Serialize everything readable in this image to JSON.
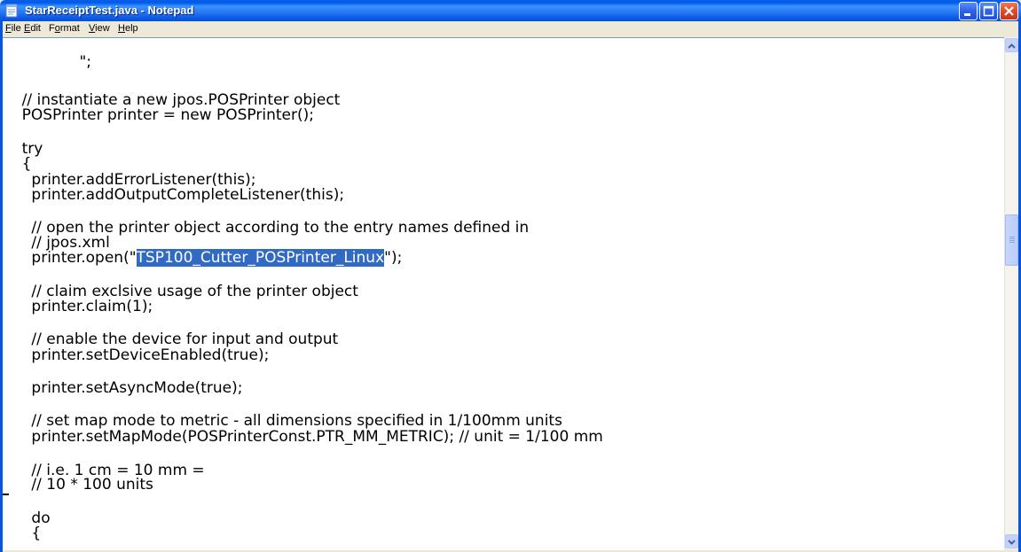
{
  "window": {
    "title": "StarReceiptTest.java - Notepad"
  },
  "menu": {
    "items": [
      {
        "before": "",
        "key": "F",
        "after": "ile"
      },
      {
        "before": "",
        "key": "E",
        "after": "dit"
      },
      {
        "before": "F",
        "key": "o",
        "after": "rmat"
      },
      {
        "before": "",
        "key": "V",
        "after": "iew"
      },
      {
        "before": "",
        "key": "H",
        "after": "elp"
      }
    ]
  },
  "editor": {
    "lines": [
      "                \";",
      "",
      "    // instantiate a new jpos.POSPrinter object",
      "    POSPrinter printer = new POSPrinter();",
      "",
      "    try",
      "    {",
      "      printer.addErrorListener(this);",
      "      printer.addOutputCompleteListener(this);",
      "",
      "      // open the printer object according to the entry names defined in",
      "      // jpos.xml",
      "",
      "",
      "      // claim exclsive usage of the printer object",
      "      printer.claim(1);",
      "",
      "      // enable the device for input and output",
      "      printer.setDeviceEnabled(true);",
      "",
      "      printer.setAsyncMode(true);",
      "",
      "      // set map mode to metric - all dimensions specified in 1/100mm units",
      "      printer.setMapMode(POSPrinterConst.PTR_MM_METRIC); // unit = 1/100 mm",
      "",
      "      // i.e. 1 cm = 10 mm =",
      "      // 10 * 100 units",
      "",
      "      do",
      "      {"
    ],
    "open_line": {
      "prefix": "      printer.open(\"",
      "selected": "TSP100_Cutter_POSPrinter_Linux",
      "suffix": "\");"
    }
  },
  "colors": {
    "titlebar": "#0A5AE6",
    "selection": "#316AC5",
    "chrome": "#ECE9D8"
  },
  "icons": {
    "app": "notepad-icon",
    "minimize": "minimize-icon",
    "maximize": "maximize-icon",
    "close": "close-icon",
    "scroll_up": "scroll-up-arrow-icon",
    "scroll_down": "scroll-down-arrow-icon"
  }
}
